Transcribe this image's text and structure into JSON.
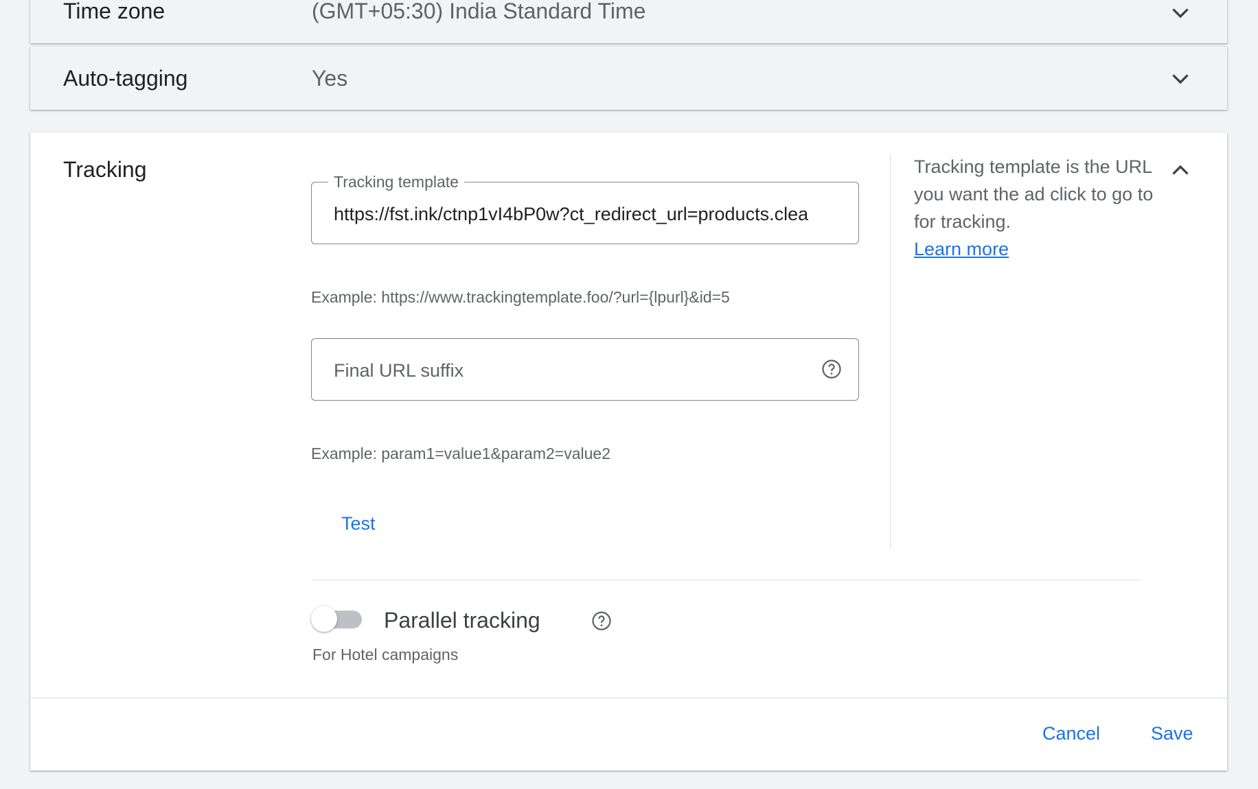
{
  "time_zone": {
    "label": "Time zone",
    "value": "(GMT+05:30) India Standard Time",
    "icon": "chevron-down-icon"
  },
  "auto_tagging": {
    "label": "Auto-tagging",
    "value": "Yes",
    "icon": "chevron-down-icon"
  },
  "tracking": {
    "label": "Tracking",
    "collapse_icon": "chevron-up-icon",
    "template_field": {
      "label": "Tracking template",
      "value": "https://fst.ink/ctnp1vI4bP0w?ct_redirect_url=products.clea"
    },
    "template_example": "Example: https://www.trackingtemplate.foo/?url={lpurl}&id=5",
    "suffix_field": {
      "placeholder": "Final URL suffix",
      "icon": "help-icon"
    },
    "suffix_example": "Example: param1=value1&param2=value2",
    "test_label": "Test",
    "help_text": "Tracking template is the URL you want the ad click to go to for tracking.",
    "learn_more": "Learn more",
    "parallel_tracking": {
      "label": "Parallel tracking",
      "sub": "For Hotel campaigns",
      "enabled": false,
      "icon": "help-icon"
    }
  },
  "footer": {
    "cancel_label": "Cancel",
    "save_label": "Save"
  },
  "colors": {
    "accent": "#1a73e8",
    "background": "#f1f3f4",
    "text": "#202124",
    "muted": "#5f6368"
  }
}
